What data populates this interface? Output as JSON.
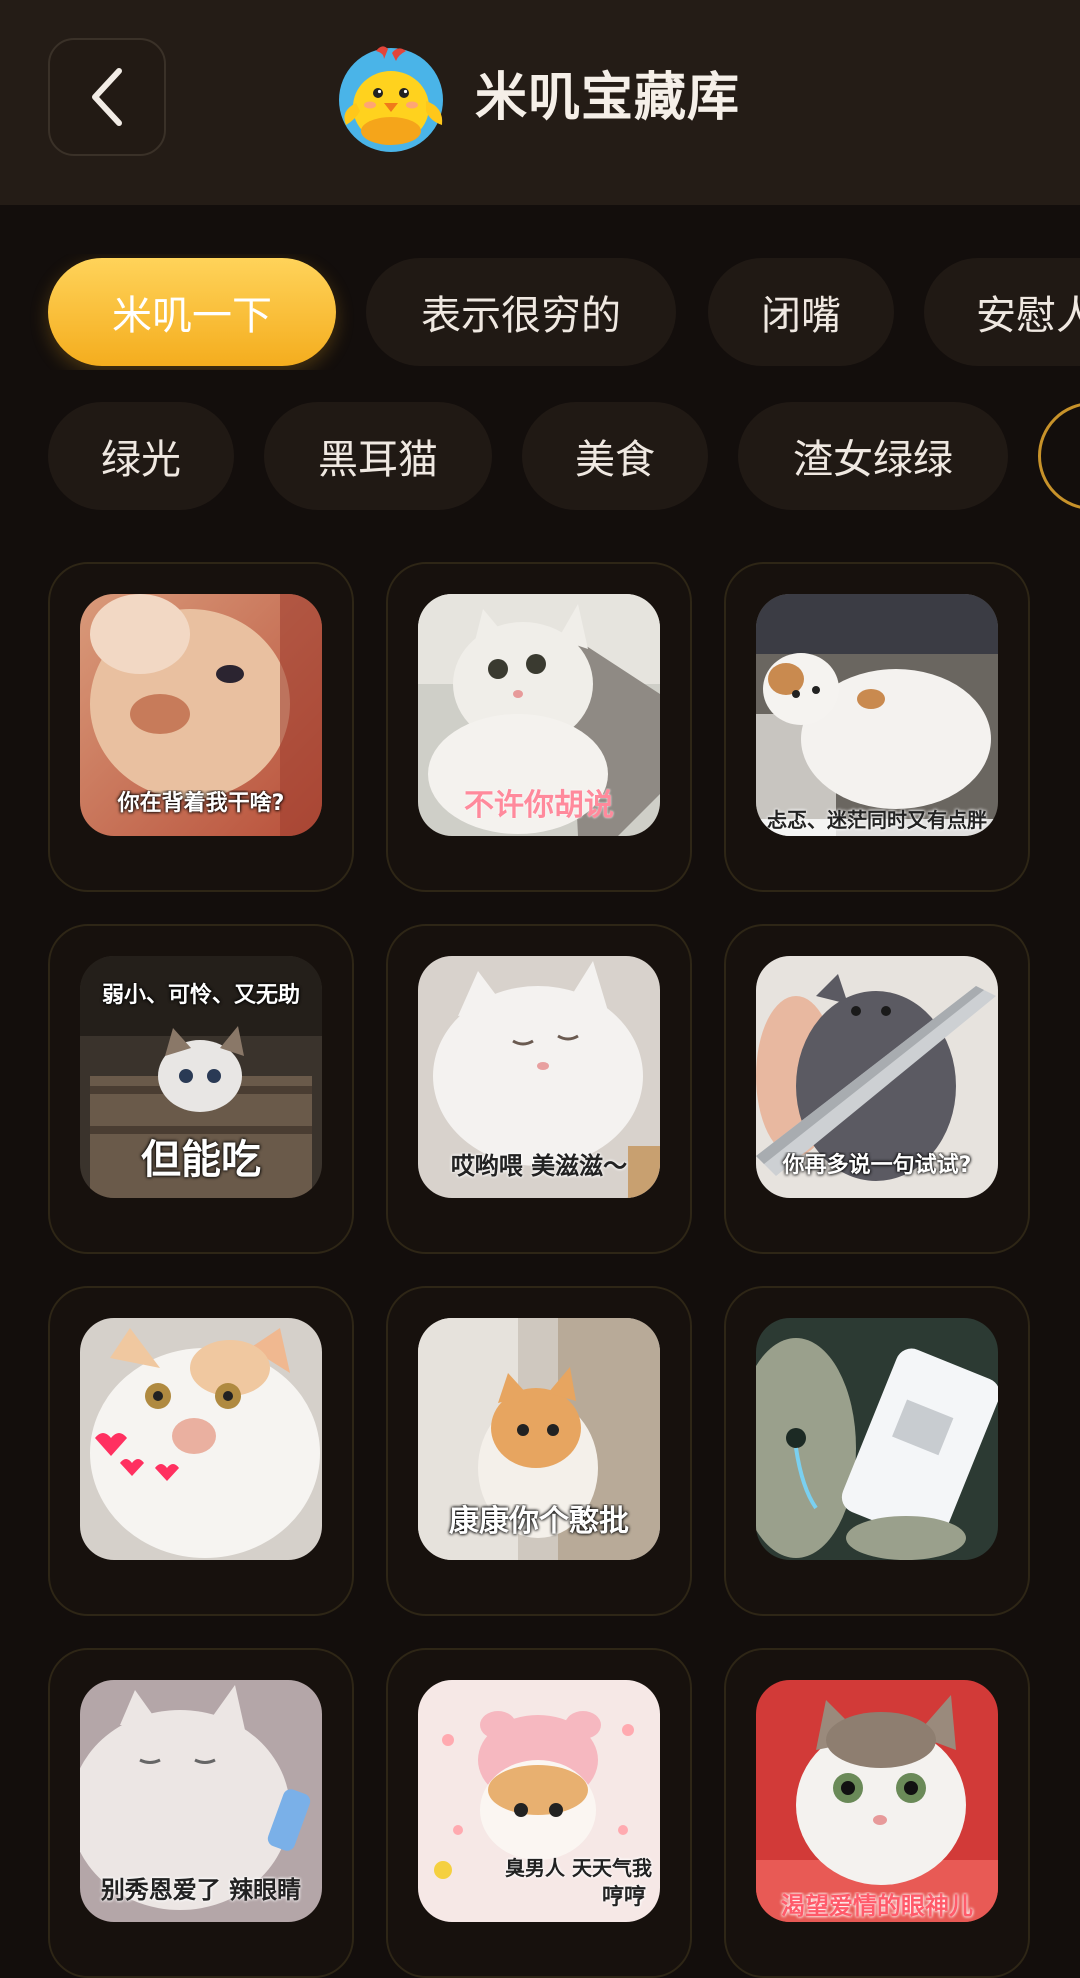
{
  "header": {
    "title": "米叽宝藏库",
    "back_icon": "chevron-left-icon",
    "mascot_icon": "yellow-chick-icon"
  },
  "colors": {
    "background": "#130e0c",
    "header": "#241c16",
    "accent": "#f8bf33",
    "chip": "#201914"
  },
  "tags_row1": [
    {
      "label": "米叽一下",
      "active": true
    },
    {
      "label": "表示很穷的",
      "active": false
    },
    {
      "label": "闭嘴",
      "active": false
    },
    {
      "label": "安慰人",
      "active": false
    }
  ],
  "tags_row2": [
    {
      "label": "绿光",
      "active": false
    },
    {
      "label": "黑耳猫",
      "active": false
    },
    {
      "label": "美食",
      "active": false
    },
    {
      "label": "渣女绿绿",
      "active": false
    }
  ],
  "stickers": [
    {
      "caption": "你在背着我干啥?"
    },
    {
      "caption": "不许你胡说"
    },
    {
      "caption": "忐忑、迷茫同时又有点胖"
    },
    {
      "caption_top": "弱小、可怜、又无助",
      "caption": "但能吃"
    },
    {
      "caption": "哎哟喂 美滋滋～"
    },
    {
      "caption": "你再多说一句试试?"
    },
    {
      "caption": ""
    },
    {
      "caption": "康康你个憨批"
    },
    {
      "caption": ""
    },
    {
      "caption": "别秀恩爱了 辣眼睛"
    },
    {
      "caption_top": "臭男人 天天气我",
      "caption": "哼哼"
    },
    {
      "caption": "渴望爱情的眼神儿"
    }
  ]
}
